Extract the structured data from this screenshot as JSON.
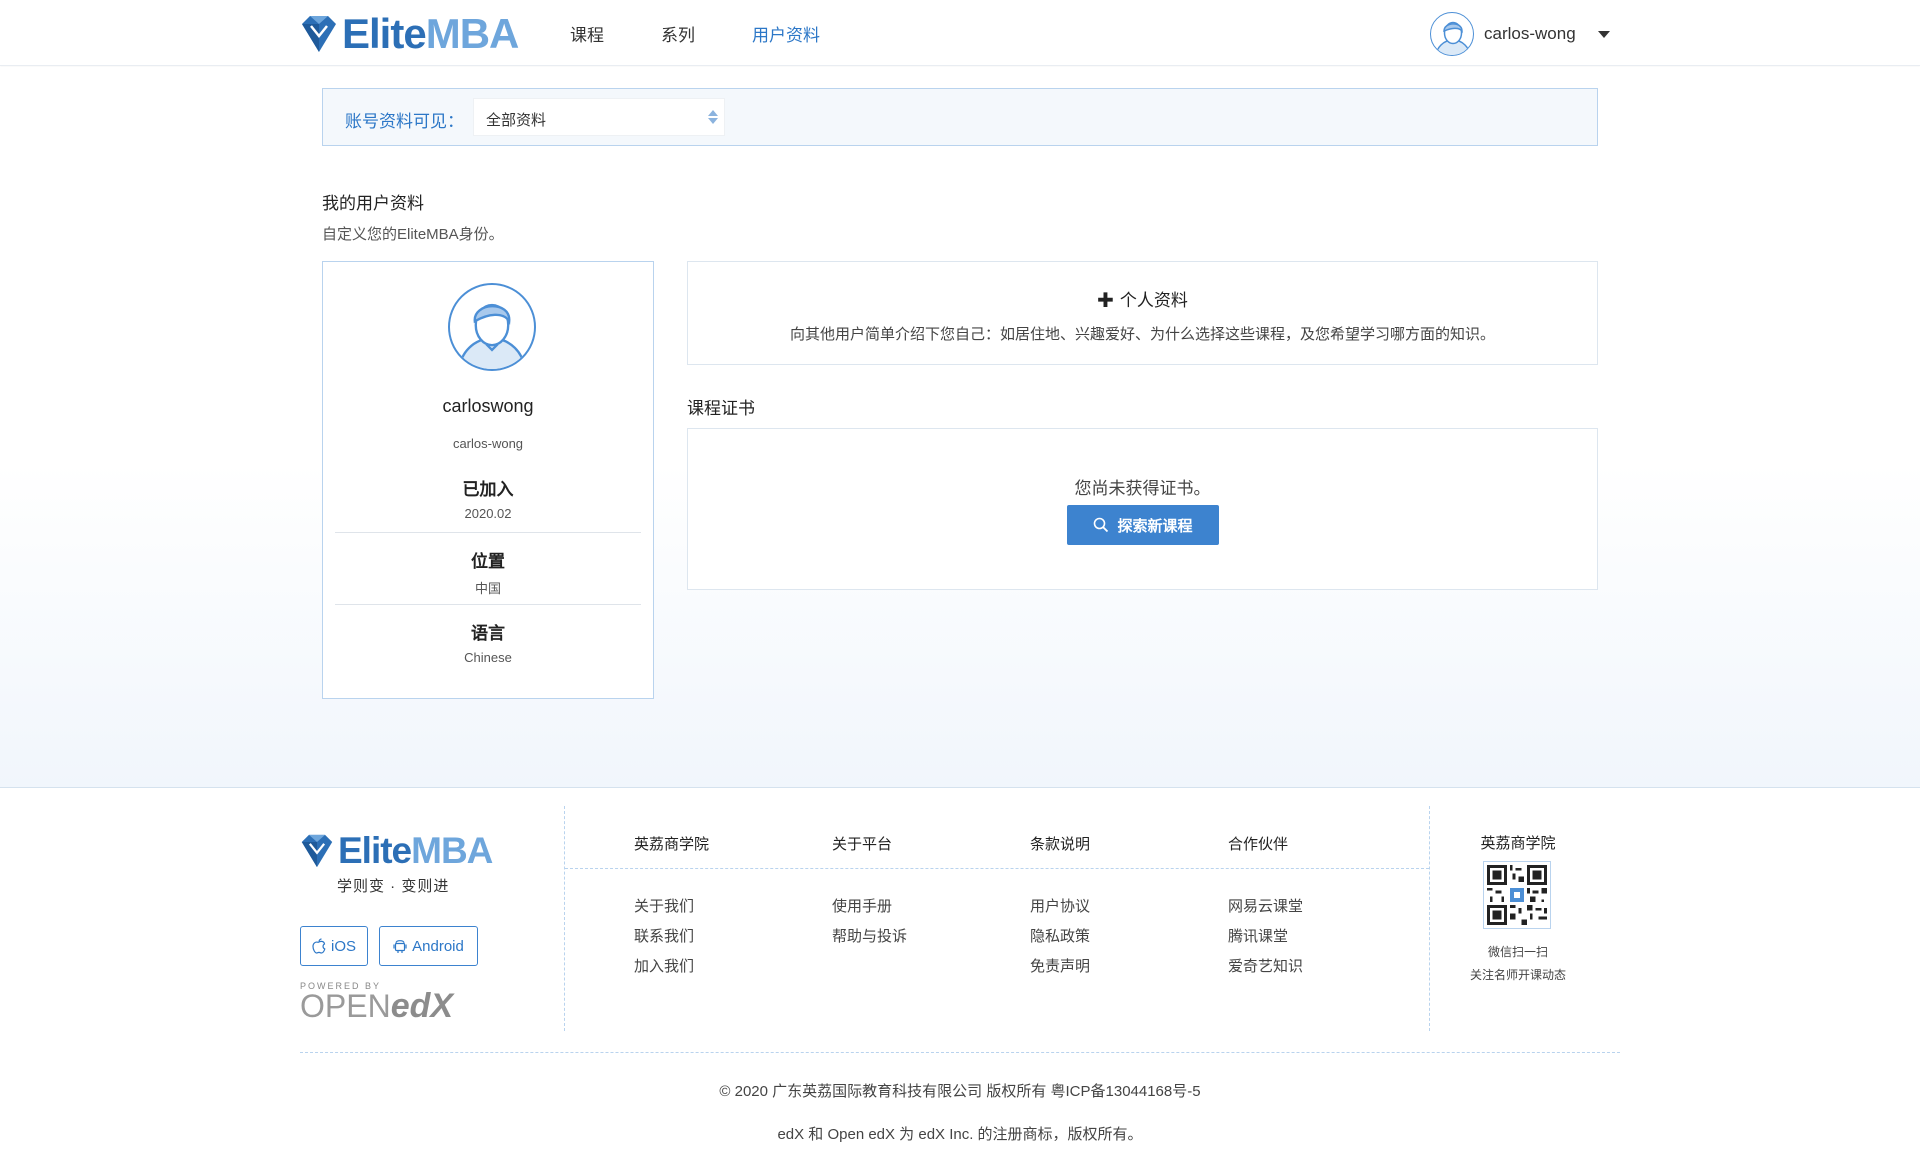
{
  "header": {
    "brand_a": "Elite",
    "brand_b": "MBA",
    "nav": [
      {
        "label": "课程",
        "active": false
      },
      {
        "label": "系列",
        "active": false
      },
      {
        "label": "用户资料",
        "active": true
      }
    ],
    "username": "carlos-wong"
  },
  "visibility": {
    "label": "账号资料可见：",
    "selected": "全部资料"
  },
  "profile_section": {
    "title": "我的用户资料",
    "subtitle": "自定义您的EliteMBA身份。"
  },
  "profile_card": {
    "full_name": "carloswong",
    "username": "carlos-wong",
    "joined_label": "已加入",
    "joined_value": "2020.02",
    "location_label": "位置",
    "location_value": "中国",
    "language_label": "语言",
    "language_value": "Chinese"
  },
  "about": {
    "title": "个人资料",
    "description": "向其他用户简单介绍下您自己：如居住地、兴趣爱好、为什么选择这些课程，及您希望学习哪方面的知识。"
  },
  "certificates": {
    "title": "课程证书",
    "empty_text": "您尚未获得证书。",
    "button_label": "探索新课程"
  },
  "footer": {
    "brand_a": "Elite",
    "brand_b": "MBA",
    "slogan": "学则变 · 变则进",
    "ios_label": "iOS",
    "android_label": "Android",
    "powered_small": "POWERED BY",
    "powered_open": "OPEN",
    "powered_edx": "edX",
    "columns": [
      {
        "head": "英荔商学院",
        "links": [
          "关于我们",
          "联系我们",
          "加入我们"
        ]
      },
      {
        "head": "关于平台",
        "links": [
          "使用手册",
          "帮助与投诉"
        ]
      },
      {
        "head": "条款说明",
        "links": [
          "用户协议",
          "隐私政策",
          "免责声明"
        ]
      },
      {
        "head": "合作伙伴",
        "links": [
          "网易云课堂",
          "腾讯课堂",
          "爱奇艺知识"
        ]
      }
    ],
    "qr_title": "英荔商学院",
    "qr_caption_1": "微信扫一扫",
    "qr_caption_2": "关注名师开课动态",
    "copyright": "© 2020 广东英荔国际教育科技有限公司 版权所有 粤ICP备13044168号-5",
    "trademark": "edX 和 Open edX 为 edX Inc. 的注册商标，版权所有。"
  },
  "colors": {
    "accent": "#2c77c7",
    "brand_dark": "#2c6fb6",
    "brand_light": "#6ea6dc",
    "border": "#b9d3ee"
  },
  "icons": [
    "diamond-logo-icon",
    "avatar-icon",
    "caret-down-icon",
    "select-arrows-icon",
    "plus-icon",
    "search-icon",
    "apple-icon",
    "android-icon",
    "qr-code-icon"
  ]
}
